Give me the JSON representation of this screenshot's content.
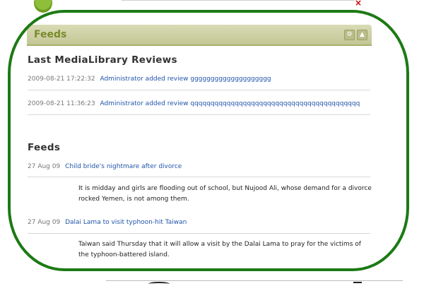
{
  "top": {
    "close_label": "×"
  },
  "panel": {
    "title": "Feeds",
    "settings_icon": "gear-icon",
    "collapse_icon": "arrow-up-icon"
  },
  "reviews": {
    "heading": "Last MediaLibrary Reviews",
    "items": [
      {
        "timestamp": "2009-08-21 17:22:32",
        "text": "Administrator added review gggggggggggggggggggg"
      },
      {
        "timestamp": "2009-08-21 11:36:23",
        "text": "Administrator added review qqqqqqqqqqqqqqqqqqqqqqqqqqqqqqqqqqqqqqqqqq"
      }
    ]
  },
  "feeds": {
    "heading": "Feeds",
    "items": [
      {
        "date": "27 Aug 09",
        "title": "Child bride's nightmare after divorce",
        "description": "It is midday and girls are flooding out of school, but Nujood Ali, whose demand for a divorce rocked Yemen, is not among them."
      },
      {
        "date": "27 Aug 09",
        "title": "Dalai Lama to visit typhoon-hit Taiwan",
        "description": "Taiwan said Thursday that it will allow a visit by the Dalai Lama to pray for the victims of the typhoon-battered island."
      }
    ]
  },
  "colors": {
    "highlight_oval": "#1c7a14",
    "link": "#2255aa",
    "header_bg": "#c3c795"
  }
}
